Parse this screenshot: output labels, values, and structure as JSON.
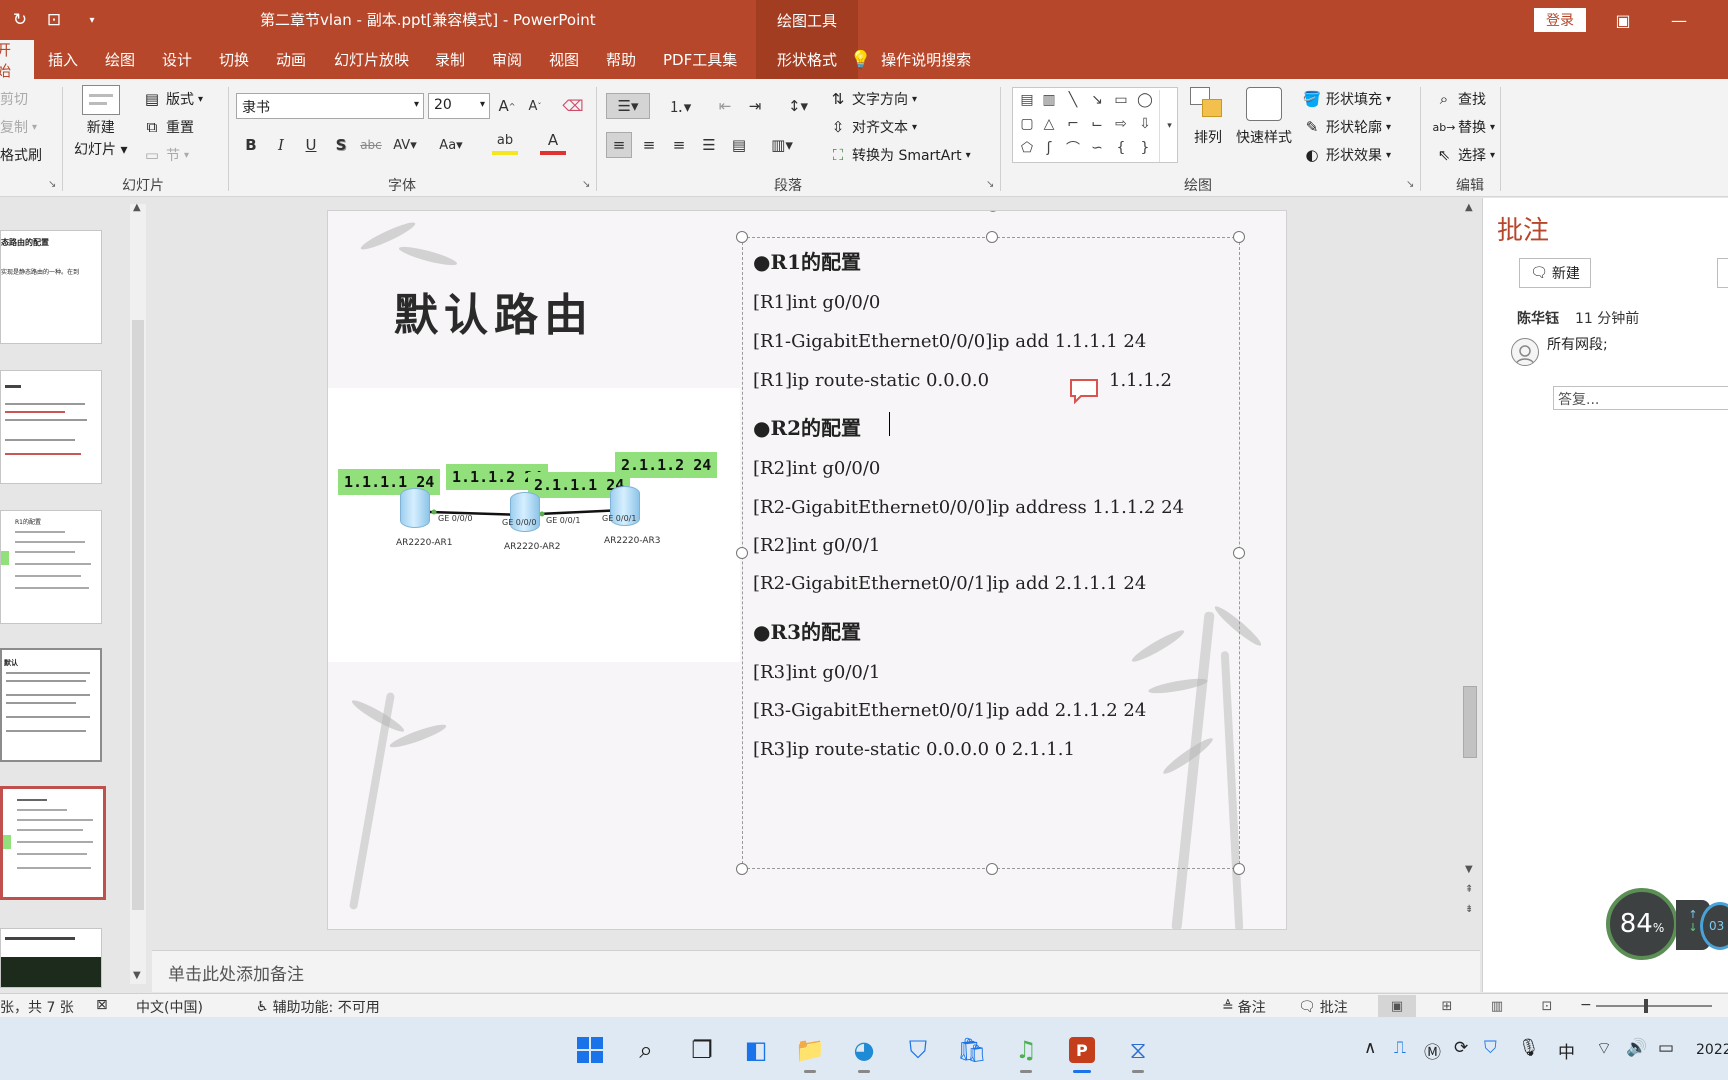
{
  "app": {
    "document_title": "第二章节vlan - 副本.ppt[兼容模式]  -  PowerPoint",
    "context_tool_tab": "绘图工具",
    "login_label": "登录"
  },
  "tabs": [
    "开始",
    "插入",
    "绘图",
    "设计",
    "切换",
    "动画",
    "幻灯片放映",
    "录制",
    "审阅",
    "视图",
    "帮助",
    "PDF工具集",
    "形状格式"
  ],
  "tell_me": "操作说明搜索",
  "ribbon": {
    "clipboard": {
      "cut": "剪切",
      "copy": "复制",
      "format_painter": "格式刷"
    },
    "slides": {
      "new_slide_line1": "新建",
      "new_slide_line2": "幻灯片",
      "layout": "版式",
      "reset": "重置",
      "section": "节",
      "group": "幻灯片"
    },
    "font": {
      "font_name": "隶书",
      "font_size": "20",
      "group": "字体"
    },
    "paragraph": {
      "text_direction": "文字方向",
      "align_text": "对齐文本",
      "convert_smartart": "转换为 SmartArt",
      "group": "段落"
    },
    "drawing": {
      "arrange": "排列",
      "quick_styles": "快速样式",
      "shape_fill": "形状填充",
      "shape_outline": "形状轮廓",
      "shape_effects": "形状效果",
      "group": "绘图"
    },
    "editing": {
      "find": "查找",
      "replace": "替换",
      "select": "选择",
      "group": "编辑"
    }
  },
  "slide": {
    "title": "默认路由",
    "diagram": {
      "ip_labels": [
        "1.1.1.1 24",
        "1.1.1.2 24",
        "2.1.1.1 24",
        "2.1.1.2 24"
      ],
      "routers": [
        "AR2220-AR1",
        "AR2220-AR2",
        "AR2220-AR3"
      ],
      "ports": [
        "GE 0/0/0",
        "GE 0/0/0",
        "GE 0/0/1",
        "GE 0/0/1"
      ]
    },
    "content": {
      "r1_heading": "●R1的配置",
      "r1_lines": [
        "[R1]int g0/0/0",
        "[R1-GigabitEthernet0/0/0]ip add 1.1.1.1 24",
        "[R1]ip route-static  0.0.0.0",
        "1.1.1.2"
      ],
      "r2_heading": "●R2的配置",
      "r2_lines": [
        "[R2]int g0/0/0",
        "[R2-GigabitEthernet0/0/0]ip address 1.1.1.2 24",
        "[R2]int g0/0/1",
        "[R2-GigabitEthernet0/0/1]ip add 2.1.1.1 24"
      ],
      "r3_heading": "●R3的配置",
      "r3_lines": [
        "[R3]int g0/0/1",
        "[R3-GigabitEthernet0/0/1]ip add 2.1.1.2 24",
        "[R3]ip route-static 0.0.0.0 0 2.1.1.1"
      ]
    }
  },
  "notes_placeholder": "单击此处添加备注",
  "comments": {
    "title": "批注",
    "new_label": "新建",
    "author": "陈华钰",
    "time": "11 分钟前",
    "text": "所有网段;",
    "reply_placeholder": "答复..."
  },
  "thumbnails": {
    "t1_title": "态路由的配置",
    "t1_sub": "实现是静态路由的一种。在到",
    "t3_title": "R1的配置",
    "t4_title": "默认"
  },
  "status": {
    "slide_count": "张，共 7 张",
    "language": "中文(中国)",
    "accessibility": "辅助功能: 不可用",
    "notes": "备注",
    "comments": "批注"
  },
  "zoom_widget": {
    "value": "84",
    "unit": "%",
    "side_value": "03"
  },
  "taskbar": {
    "ime": "中",
    "year": "2022"
  },
  "colors": {
    "accent": "#b7472a",
    "ip_label_bg": "#92e07c"
  }
}
